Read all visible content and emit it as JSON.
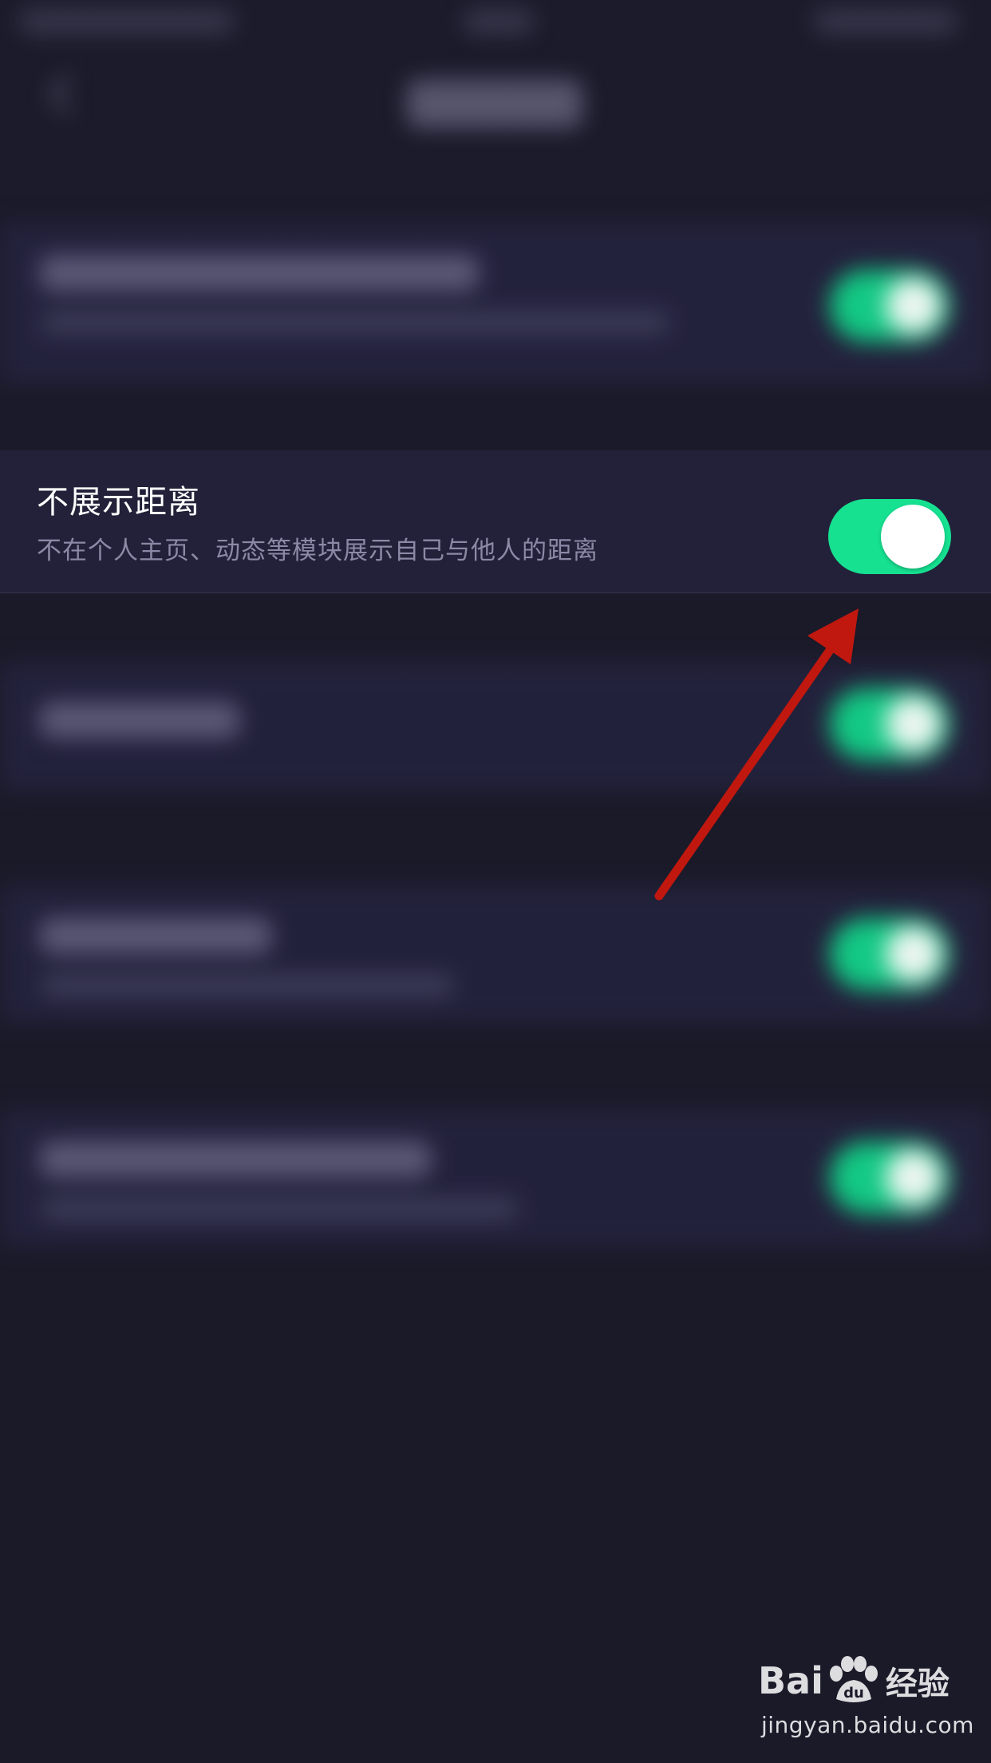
{
  "privacy_item": {
    "title": "不展示距离",
    "description": "不在个人主页、动态等模块展示自己与他人的距离",
    "toggle_on": true
  },
  "annotation": {
    "arrow_color": "#c0180f"
  },
  "watermark": {
    "brand": "Bai",
    "brand_suffix": "经验",
    "url": "jingyan.baidu.com"
  },
  "colors": {
    "background": "#1b1a29",
    "row_background": "#222139",
    "toggle_on": "#16e191",
    "title": "#ffffff",
    "description": "#8b8aa6"
  }
}
